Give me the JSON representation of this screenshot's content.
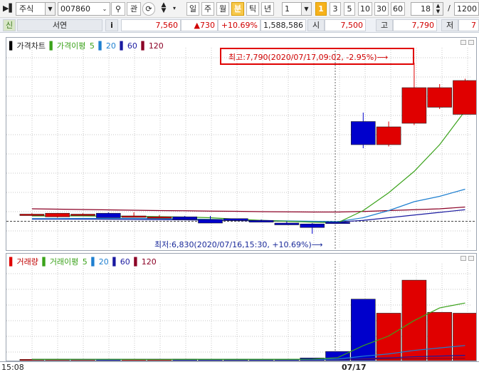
{
  "toolbar": {
    "market": "주식",
    "code": "007860",
    "search_icon": "magnifier-icon",
    "related_btn": "관",
    "period_tabs": [
      "일",
      "주",
      "월",
      "분",
      "틱",
      "년"
    ],
    "active_period": "분",
    "interval_value": "1",
    "interval_buttons": [
      "1",
      "3",
      "5",
      "10",
      "30",
      "60"
    ],
    "active_interval": "1",
    "count_value": "18",
    "slash": "/",
    "total_value": "1200"
  },
  "info": {
    "credit_badge": "신",
    "stock_name": "서연",
    "info_btn": "i",
    "price": "7,560",
    "change": "▲730",
    "change_pct": "+10.69%",
    "volume": "1,588,586",
    "open_label": "시",
    "open_value": "7,500",
    "high_label": "고",
    "high_value": "7,790",
    "low_label": "저",
    "low_value": "7"
  },
  "price_legend": {
    "title": "가격차트",
    "ma_label": "가격이평",
    "ma_periods": [
      "5",
      "20",
      "60",
      "120"
    ]
  },
  "volume_legend": {
    "title": "거래량",
    "ma_label": "거래이평",
    "ma_periods": [
      "5",
      "20",
      "60",
      "120"
    ]
  },
  "annotations": {
    "max_label": "최고:7,790(2020/07/17,09:02, -2.95%)⟶",
    "min_label": "최저:6,830(2020/07/16,15:30, +10.69%)⟶"
  },
  "time_axis": {
    "left_label": "15:08",
    "date_label": "07/17"
  },
  "colors": {
    "up": "#e00000",
    "down": "#0000cc",
    "ma5": "#3aa21a",
    "ma20": "#1e7fd0",
    "ma60": "#1a1aa0",
    "ma120": "#8b0025",
    "accent_active": "#f0a800"
  },
  "chart_data": [
    {
      "type": "candlestick",
      "ylim": [
        6750,
        7850
      ],
      "candles": [
        {
          "o": 6935,
          "h": 6945,
          "l": 6930,
          "c": 6940
        },
        {
          "o": 6925,
          "h": 6945,
          "l": 6920,
          "c": 6945
        },
        {
          "o": 6935,
          "h": 6945,
          "l": 6930,
          "c": 6940
        },
        {
          "o": 6945,
          "h": 6950,
          "l": 6925,
          "c": 6920
        },
        {
          "o": 6930,
          "h": 6950,
          "l": 6925,
          "c": 6930
        },
        {
          "o": 6925,
          "h": 6935,
          "l": 6920,
          "c": 6925
        },
        {
          "o": 6925,
          "h": 6930,
          "l": 6910,
          "c": 6910
        },
        {
          "o": 6910,
          "h": 6930,
          "l": 6895,
          "c": 6890
        },
        {
          "o": 6915,
          "h": 6915,
          "l": 6905,
          "c": 6905
        },
        {
          "o": 6905,
          "h": 6910,
          "l": 6895,
          "c": 6895
        },
        {
          "o": 6890,
          "h": 6900,
          "l": 6880,
          "c": 6880
        },
        {
          "o": 6885,
          "h": 6890,
          "l": 6830,
          "c": 6865
        },
        {
          "o": 6895,
          "h": 6895,
          "l": 6890,
          "c": 6890
        },
        {
          "o": 7460,
          "h": 7510,
          "l": 7310,
          "c": 7330
        },
        {
          "o": 7330,
          "h": 7460,
          "l": 7320,
          "c": 7430
        },
        {
          "o": 7450,
          "h": 7790,
          "l": 7440,
          "c": 7650
        },
        {
          "o": 7540,
          "h": 7670,
          "l": 7530,
          "c": 7650
        },
        {
          "o": 7500,
          "h": 7700,
          "l": 7500,
          "c": 7690
        }
      ],
      "ma5": [
        6930,
        6930,
        6930,
        6928,
        6928,
        6926,
        6924,
        6920,
        6912,
        6905,
        6900,
        6895,
        6892,
        6960,
        7060,
        7180,
        7330,
        7520
      ],
      "ma20": [
        6915,
        6915,
        6916,
        6916,
        6916,
        6915,
        6913,
        6911,
        6908,
        6905,
        6902,
        6900,
        6898,
        6920,
        6960,
        7010,
        7040,
        7080
      ],
      "ma60": [
        6912,
        6912,
        6912,
        6911,
        6910,
        6909,
        6908,
        6906,
        6904,
        6902,
        6900,
        6898,
        6896,
        6905,
        6920,
        6935,
        6950,
        6965
      ],
      "ma120": [
        6970,
        6968,
        6966,
        6964,
        6962,
        6960,
        6959,
        6957,
        6956,
        6954,
        6953,
        6952,
        6952,
        6955,
        6960,
        6965,
        6970,
        6980
      ]
    },
    {
      "type": "bar",
      "ylim": [
        0,
        560000
      ],
      "volume": [
        7000,
        8000,
        7000,
        8000,
        6000,
        5000,
        9000,
        8000,
        5000,
        7000,
        6000,
        15000,
        52000,
        350000,
        270000,
        458000,
        275000,
        270000
      ],
      "ma5": [
        7000,
        7200,
        7300,
        7400,
        7200,
        6800,
        7000,
        7200,
        7000,
        7000,
        7000,
        8400,
        17000,
        85000,
        140000,
        228000,
        300000,
        328000
      ],
      "ma20": [
        6000,
        6100,
        6200,
        6300,
        6300,
        6300,
        6400,
        6500,
        6500,
        6600,
        6600,
        7000,
        9000,
        25000,
        38000,
        58000,
        72000,
        86000
      ],
      "ma60": [
        6500,
        6500,
        6500,
        6500,
        6500,
        6500,
        6500,
        6500,
        6500,
        6500,
        6500,
        6600,
        7000,
        12000,
        16000,
        22000,
        26000,
        30000
      ],
      "ma120": [
        7000,
        7000,
        7000,
        7000,
        7000,
        7000,
        7000,
        7000,
        7000,
        7000,
        7000,
        7000,
        7200,
        9000,
        10000,
        11500,
        12500,
        13500
      ]
    }
  ]
}
